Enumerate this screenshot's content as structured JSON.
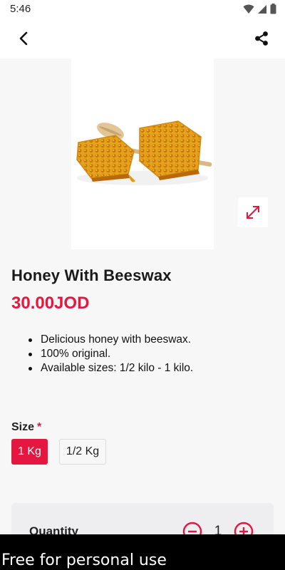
{
  "status_bar": {
    "time": "5:46"
  },
  "icons": {
    "back": "back-arrow-icon",
    "share": "share-icon",
    "expand": "expand-icon",
    "minus": "minus-circle-icon",
    "plus": "plus-circle-icon"
  },
  "product": {
    "title": "Honey With Beeswax",
    "price": "30.00JOD",
    "description": [
      "Delicious honey with beeswax.",
      "100% original.",
      "Available sizes: 1/2 kilo - 1 kilo."
    ]
  },
  "size": {
    "label": "Size",
    "required_marker": "*",
    "options": [
      "1 Kg",
      "1/2 Kg"
    ],
    "selected": "1 Kg"
  },
  "quantity": {
    "label": "Quantity",
    "value": "1"
  },
  "watermark": {
    "text": "Free for personal use"
  },
  "colors": {
    "accent": "#e5163f",
    "background": "#f7f7f7",
    "card": "#eeedf0"
  }
}
